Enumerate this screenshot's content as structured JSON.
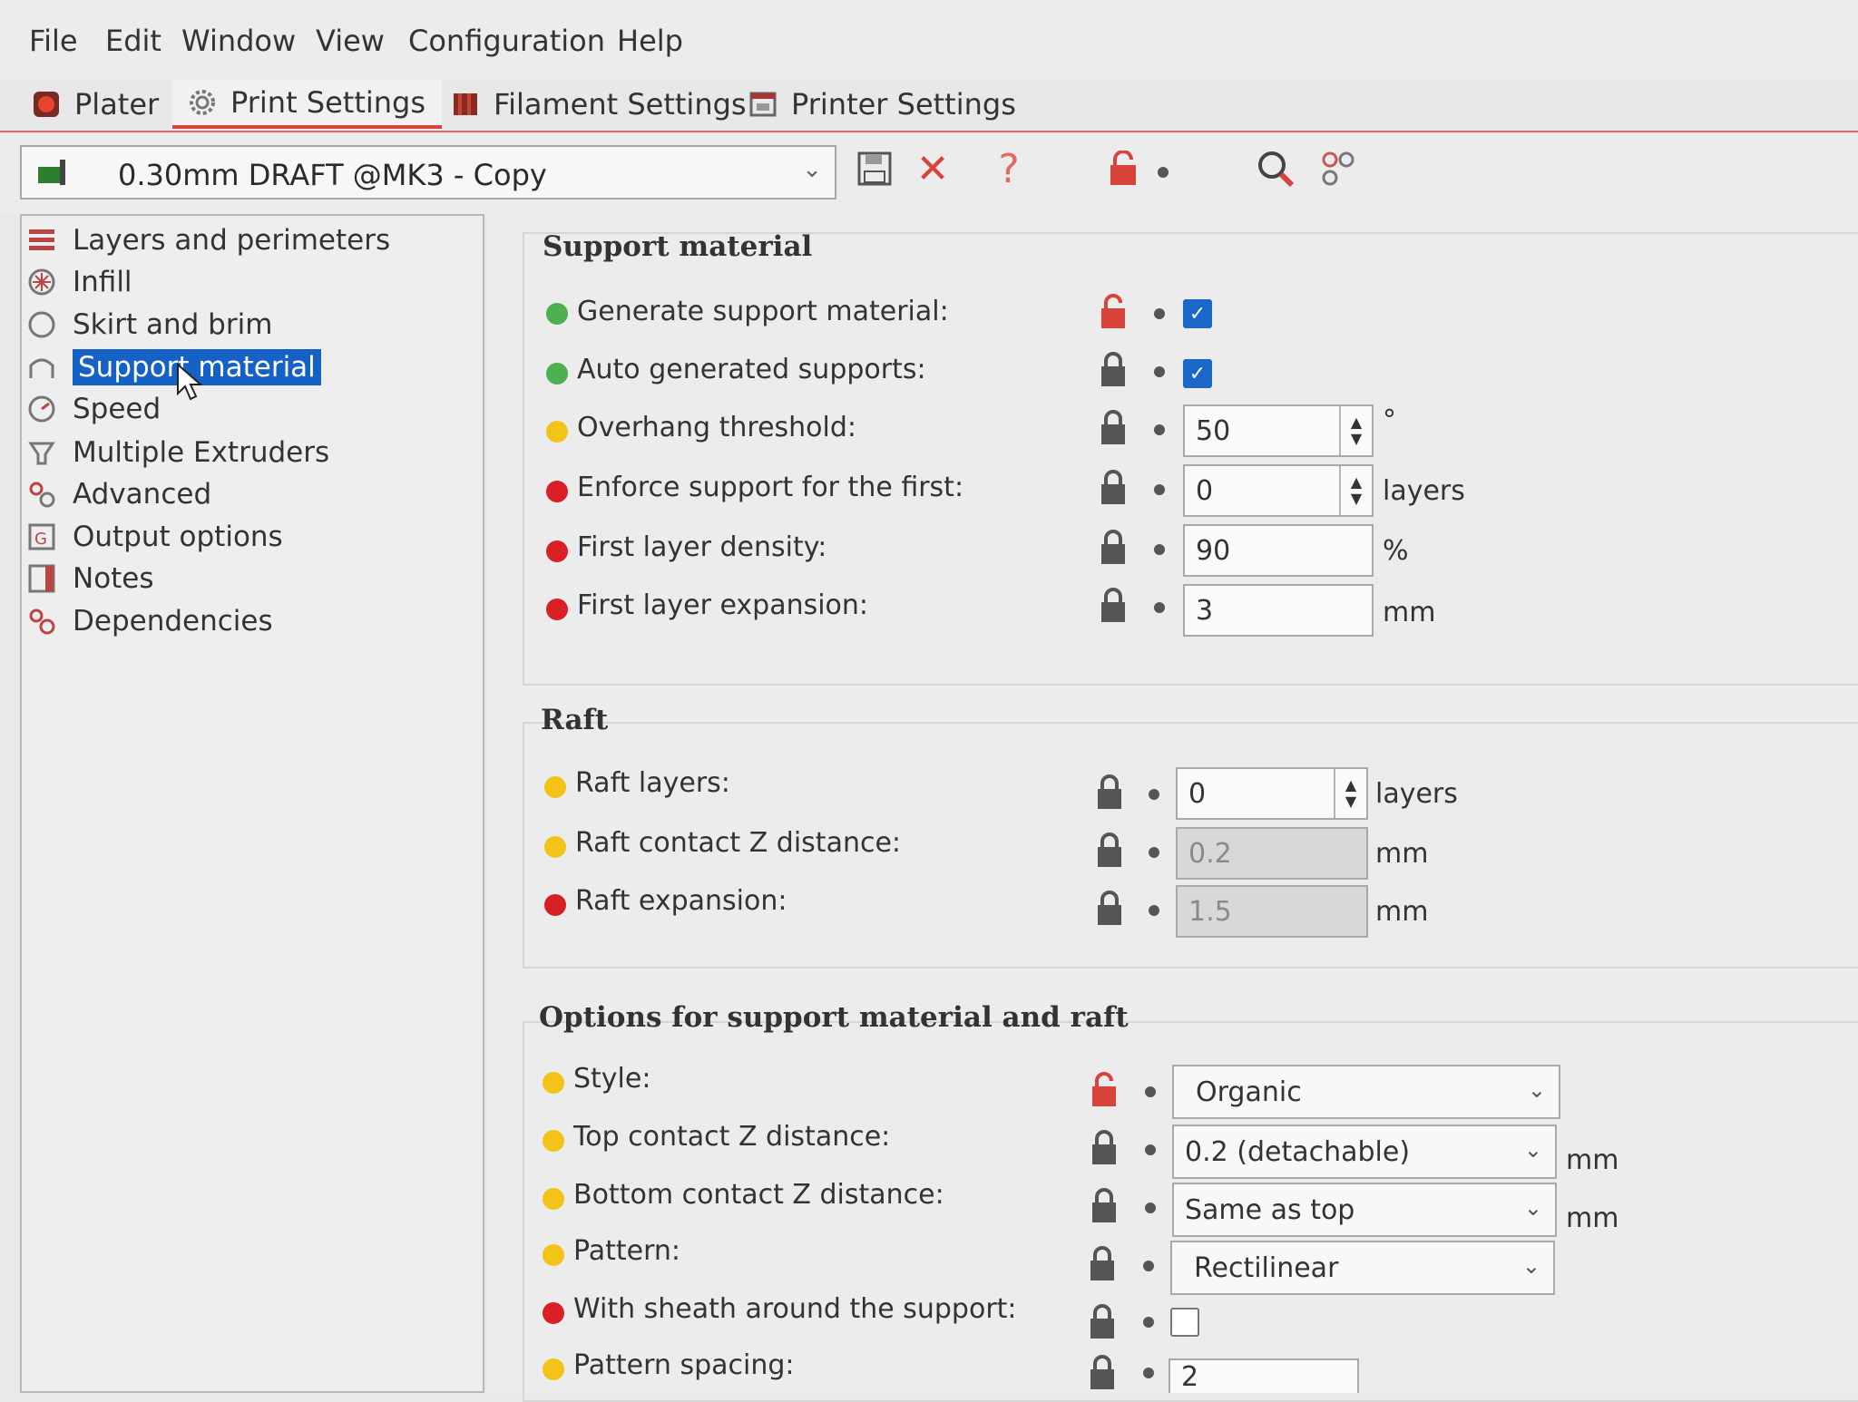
{
  "menu": [
    "File",
    "Edit",
    "Window",
    "View",
    "Configuration",
    "Help"
  ],
  "tabs": [
    {
      "label": "Plater",
      "icon": "plater-icon"
    },
    {
      "label": "Print Settings",
      "icon": "gear-icon"
    },
    {
      "label": "Filament Settings",
      "icon": "filament-spool-icon"
    },
    {
      "label": "Printer Settings",
      "icon": "printer-icon"
    }
  ],
  "preset": {
    "name": "0.30mm DRAFT @MK3 - Copy"
  },
  "sidebar": {
    "selected": "Support material",
    "items": [
      {
        "label": "Layers and perimeters",
        "icon": "layers-icon"
      },
      {
        "label": "Infill",
        "icon": "infill-icon"
      },
      {
        "label": "Skirt and brim",
        "icon": "skirt-icon"
      },
      {
        "label": "Support material",
        "icon": "support-icon"
      },
      {
        "label": "Speed",
        "icon": "speed-icon"
      },
      {
        "label": "Multiple Extruders",
        "icon": "extruders-icon"
      },
      {
        "label": "Advanced",
        "icon": "advanced-icon"
      },
      {
        "label": "Output options",
        "icon": "output-icon"
      },
      {
        "label": "Notes",
        "icon": "notes-icon"
      },
      {
        "label": "Dependencies",
        "icon": "dependencies-icon"
      }
    ]
  },
  "sections": {
    "support": {
      "title": "Support material",
      "rows": [
        {
          "label": "Generate support material:",
          "mode": "green",
          "lock": "unlocked",
          "type": "checkbox",
          "checked": true
        },
        {
          "label": "Auto generated supports:",
          "mode": "green",
          "lock": "locked",
          "type": "checkbox",
          "checked": true
        },
        {
          "label": "Overhang threshold:",
          "mode": "yellow",
          "lock": "locked",
          "type": "spin",
          "value": "50",
          "unit": "°"
        },
        {
          "label": "Enforce support for the first:",
          "mode": "red",
          "lock": "locked",
          "type": "spin",
          "value": "0",
          "unit": "layers"
        },
        {
          "label": "First layer density:",
          "mode": "red",
          "lock": "locked",
          "type": "text",
          "value": "90",
          "unit": "%"
        },
        {
          "label": "First layer expansion:",
          "mode": "red",
          "lock": "locked",
          "type": "text",
          "value": "3",
          "unit": "mm"
        }
      ]
    },
    "raft": {
      "title": "Raft",
      "rows": [
        {
          "label": "Raft layers:",
          "mode": "yellow",
          "lock": "locked",
          "type": "spin",
          "value": "0",
          "unit": "layers"
        },
        {
          "label": "Raft contact Z distance:",
          "mode": "yellow",
          "lock": "locked",
          "type": "disabled",
          "value": "0.2",
          "unit": "mm"
        },
        {
          "label": "Raft expansion:",
          "mode": "red",
          "lock": "locked",
          "type": "disabled",
          "value": "1.5",
          "unit": "mm"
        }
      ]
    },
    "options": {
      "title": "Options for support material and raft",
      "rows": [
        {
          "label": "Style:",
          "mode": "yellow",
          "lock": "unlocked",
          "type": "combo",
          "value": "Organic",
          "unit": ""
        },
        {
          "label": "Top contact Z distance:",
          "mode": "yellow",
          "lock": "locked",
          "type": "combo",
          "value": "0.2 (detachable)",
          "unit": "mm"
        },
        {
          "label": "Bottom contact Z distance:",
          "mode": "yellow",
          "lock": "locked",
          "type": "combo",
          "value": "Same as top",
          "unit": "mm"
        },
        {
          "label": "Pattern:",
          "mode": "yellow",
          "lock": "locked",
          "type": "combo",
          "value": "Rectilinear",
          "unit": ""
        },
        {
          "label": "With sheath around the support:",
          "mode": "red",
          "lock": "locked",
          "type": "checkbox",
          "checked": false
        },
        {
          "label": "Pattern spacing:",
          "mode": "yellow",
          "lock": "locked",
          "type": "text",
          "value": "2",
          "unit": ""
        }
      ]
    }
  },
  "colors": {
    "accent": "#d8433b",
    "selection": "#1561c5",
    "checkbox": "#1b66c9"
  }
}
